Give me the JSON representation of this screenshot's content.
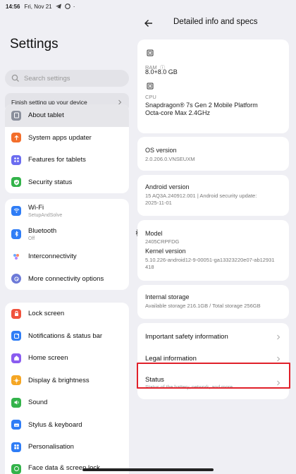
{
  "status_bar": {
    "time": "14:56",
    "date": "Fri, Nov 21"
  },
  "left": {
    "title": "Settings",
    "search_placeholder": "Search settings",
    "setup_label": "Finish setting up your device",
    "groups": [
      [
        {
          "label": "About tablet",
          "icon": "tablet-icon",
          "color": "#8a8f9c"
        },
        {
          "label": "System apps updater",
          "icon": "arrow-up-icon",
          "color": "#f36e2b"
        },
        {
          "label": "Features for tablets",
          "icon": "grid-icon",
          "color": "#6b6cf0"
        },
        {
          "label": "Security status",
          "icon": "shield-check-icon",
          "color": "#33b34a"
        }
      ],
      [
        {
          "label": "Wi-Fi",
          "sub": "SetupAndSolve",
          "icon": "wifi-icon",
          "color": "#2f7df6"
        },
        {
          "label": "Bluetooth",
          "sub": "Off",
          "icon": "bluetooth-icon",
          "color": "#2f7df6"
        },
        {
          "label": "Interconnectivity",
          "icon": "dots-icon",
          "color": "#ffffff"
        },
        {
          "label": "More connectivity options",
          "icon": "link-icon",
          "color": "#6d7ad8"
        }
      ],
      [
        {
          "label": "Lock screen",
          "icon": "lock-icon",
          "color": "#f0523d"
        },
        {
          "label": "Notifications & status bar",
          "icon": "notification-icon",
          "color": "#2f7df6"
        },
        {
          "label": "Home screen",
          "icon": "home-icon",
          "color": "#8a5cf0"
        },
        {
          "label": "Display & brightness",
          "icon": "sun-icon",
          "color": "#f5a623"
        },
        {
          "label": "Sound",
          "icon": "speaker-icon",
          "color": "#33b34a"
        },
        {
          "label": "Stylus & keyboard",
          "icon": "keyboard-icon",
          "color": "#2f7df6"
        },
        {
          "label": "Personalisation",
          "icon": "palette-icon",
          "color": "#2f7df6"
        },
        {
          "label": "Face data & screen lock",
          "icon": "face-icon",
          "color": "#33b34a"
        }
      ]
    ]
  },
  "right": {
    "title": "Detailed info and specs",
    "ram_label": "RAM",
    "ram_value": "8.0+8.0 GB",
    "cpu_label": "CPU",
    "cpu_value_1": "Snapdragon® 7s Gen 2 Mobile Platform",
    "cpu_value_2": "Octa-core Max 2.4GHz",
    "os_label": "OS version",
    "os_value": "2.0.206.0.VNSEUXM",
    "android_label": "Android version",
    "android_value_1": "15 AQ3A.240912.001 | Android security update:",
    "android_value_2": "2025-11-01",
    "model_label": "Model",
    "model_value": "2405CRPFDG",
    "kernel_label": "Kernel version",
    "kernel_value_1": "5.10.226-android12-9-00051-ga13323220e07-ab12931",
    "kernel_value_2": "418",
    "storage_label": "Internal storage",
    "storage_value": "Available storage  216.1GB / Total storage  256GB",
    "links": [
      {
        "label": "Important safety information"
      },
      {
        "label": "Legal information"
      },
      {
        "label": "Status",
        "sub": "Status of the battery, network, and more"
      }
    ]
  }
}
